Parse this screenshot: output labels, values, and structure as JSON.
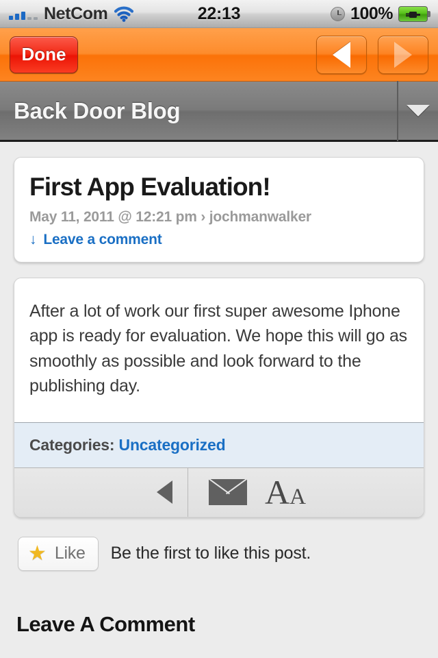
{
  "statusbar": {
    "carrier": "NetCom",
    "time": "22:13",
    "battery_percent": "100%",
    "signal_bars_filled": 3,
    "signal_bars_total": 5,
    "wifi_icon": "wifi-icon",
    "clock_icon": "alarm-clock-icon",
    "battery_icon": "battery-charging-icon"
  },
  "toolbar": {
    "done_label": "Done",
    "back_icon": "triangle-left-icon",
    "forward_icon": "triangle-right-icon"
  },
  "blogbar": {
    "title": "Back Door Blog",
    "dropdown_icon": "chevron-down-icon"
  },
  "post": {
    "title": "First App Evaluation!",
    "meta": "May 11, 2011 @ 12:21 pm › jochmanwalker",
    "comment_arrow": "↓",
    "comment_link": "Leave a comment",
    "body": "After a lot of work our first super awesome Iphone app is ready for evaluation. We hope this will go as smoothly as possible and look forward to the publishing day.",
    "categories_label": "Categories:",
    "categories_value": "Uncategorized"
  },
  "icon_bar": {
    "back_icon": "triangle-left-icon",
    "mail_icon": "envelope-icon",
    "font_size_icon": "font-size-aa-icon",
    "font_size_big": "A",
    "font_size_small": "A"
  },
  "like": {
    "star_icon": "★",
    "button_label": "Like",
    "status_text": "Be the first to like this post."
  },
  "comments": {
    "heading": "Leave A Comment"
  },
  "colors": {
    "toolbar_orange": "#fb7208",
    "done_red": "#eb1405",
    "link_blue": "#1a6fc4",
    "blogbar_gray": "#7a7a7a",
    "page_bg": "#ececec",
    "categories_bg": "#e4edf6",
    "star_gold": "#f0b822",
    "battery_green": "#57c21a"
  }
}
